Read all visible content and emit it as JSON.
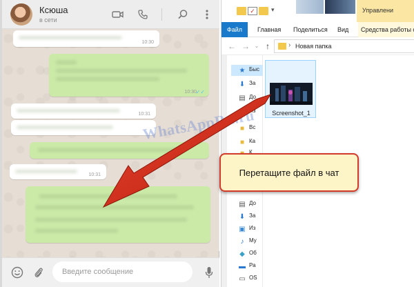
{
  "whatsapp": {
    "contact_name": "Ксюша",
    "contact_status": "в сети",
    "messages": [
      {
        "direction": "in",
        "time": "10:30"
      },
      {
        "direction": "out",
        "time": "10:30"
      },
      {
        "direction": "in",
        "time": "10:31"
      },
      {
        "direction": "in",
        "time": ""
      },
      {
        "direction": "out",
        "time": ""
      },
      {
        "direction": "in",
        "time": "10:31"
      },
      {
        "direction": "out",
        "time": ""
      }
    ],
    "input_placeholder": "Введите сообщение",
    "icons": [
      "video-call-icon",
      "voice-call-icon",
      "search-icon",
      "menu-icon",
      "emoji-icon",
      "attach-icon",
      "mic-icon"
    ]
  },
  "explorer": {
    "ribbon_context_label": "Управлени",
    "tabs": [
      "Файл",
      "Главная",
      "Поделиться",
      "Вид"
    ],
    "context_tab": "Средства работы с ри",
    "address_path": "Новая папка",
    "sidebar_items": [
      {
        "label": "Быс",
        "icon": "star-icon"
      },
      {
        "label": "За",
        "icon": "download-icon"
      },
      {
        "label": "До",
        "icon": "document-icon"
      },
      {
        "label": "Из",
        "icon": "pictures-icon"
      },
      {
        "label": "Вс",
        "icon": "folder-icon"
      },
      {
        "label": "Ка",
        "icon": "folder-icon"
      },
      {
        "label": "К",
        "icon": "folder-icon"
      },
      {
        "label": "До",
        "icon": "document-icon"
      },
      {
        "label": "За",
        "icon": "download-icon"
      },
      {
        "label": "Из",
        "icon": "pictures-icon"
      },
      {
        "label": "Му",
        "icon": "music-icon"
      },
      {
        "label": "Об",
        "icon": "objects-icon"
      },
      {
        "label": "Ра",
        "icon": "desktop-icon"
      },
      {
        "label": "OS",
        "icon": "drive-icon"
      }
    ],
    "file": {
      "name": "Screenshot_1"
    }
  },
  "overlay": {
    "callout_text": "Перетащите файл в чат",
    "watermark": "WhatsAppRu.ru"
  },
  "colors": {
    "arrow": "#d62e1f",
    "outgoing_bubble": "#cbeaa8",
    "file_tab": "#1979ca",
    "callout_border": "#d23a2a"
  }
}
